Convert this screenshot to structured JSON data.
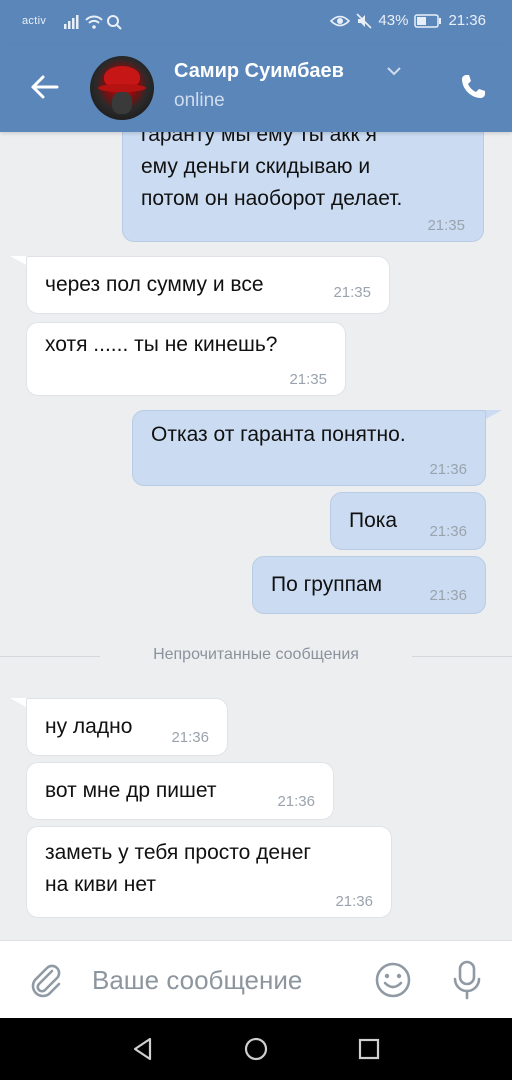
{
  "status_bar": {
    "carrier": "activ",
    "battery": "43%",
    "time": "21:36"
  },
  "header": {
    "contact_name": "Самир Суимбаев",
    "contact_status": "online"
  },
  "messages": [
    {
      "direction": "out",
      "lines": [
        "гаранту мы ему ты акк я",
        "ему деньги скидываю и",
        "потом он наоборот делает."
      ],
      "time": "21:35"
    },
    {
      "direction": "in",
      "text": "через пол сумму и все",
      "time": "21:35"
    },
    {
      "direction": "in",
      "text": "хотя ...... ты не кинешь?",
      "time": "21:35"
    },
    {
      "direction": "out",
      "text": "Отказ от гаранта понятно.",
      "time": "21:36"
    },
    {
      "direction": "out",
      "text": "Пока",
      "time": "21:36"
    },
    {
      "direction": "out",
      "text": "По группам",
      "time": "21:36"
    },
    {
      "direction": "in",
      "text": "ну ладно",
      "time": "21:36"
    },
    {
      "direction": "in",
      "text": "вот мне др пишет",
      "time": "21:36"
    },
    {
      "direction": "in",
      "lines": [
        "заметь у тебя просто денег",
        "на киви нет"
      ],
      "time": "21:36"
    }
  ],
  "unread_divider": "Непрочитанные сообщения",
  "composer": {
    "placeholder": "Ваше сообщение"
  },
  "colors": {
    "header_bg": "#5b86b9",
    "incoming_bubble": "#ffffff",
    "outgoing_bubble": "#cbdcf2",
    "chat_bg": "#edeef0"
  },
  "icons": [
    "back-arrow-icon",
    "phone-icon",
    "chevron-down-icon",
    "attach-icon",
    "emoji-icon",
    "microphone-icon",
    "nav-back-icon",
    "nav-home-icon",
    "nav-recents-icon"
  ]
}
